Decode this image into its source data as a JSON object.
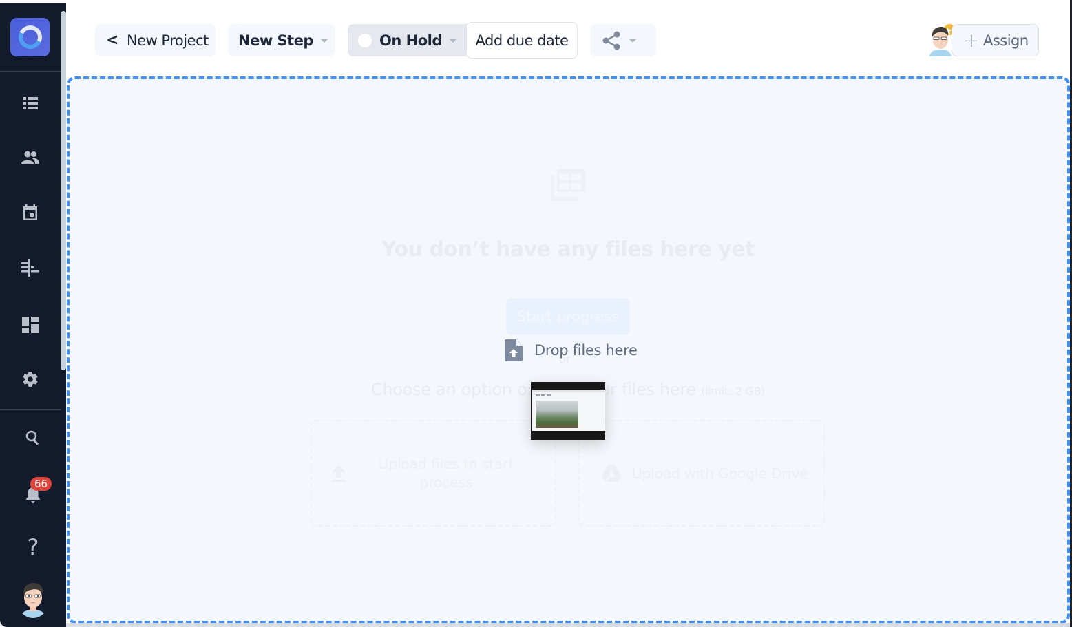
{
  "sidebar": {
    "logo": "app-logo",
    "nav_items": [
      {
        "name": "list-icon",
        "label": "Projects list"
      },
      {
        "name": "people-icon",
        "label": "Team"
      },
      {
        "name": "calendar-icon",
        "label": "Calendar"
      },
      {
        "name": "timeline-icon",
        "label": "Timeline"
      },
      {
        "name": "dashboard-icon",
        "label": "Dashboard"
      },
      {
        "name": "gear-icon",
        "label": "Settings"
      }
    ],
    "bottom_items": [
      {
        "name": "search-icon"
      },
      {
        "name": "bell-icon"
      },
      {
        "name": "help-icon"
      },
      {
        "name": "user-avatar"
      }
    ],
    "notification_count": "66",
    "help_glyph": "?"
  },
  "header": {
    "back_label": "New Project",
    "back_glyph": "<",
    "step_label": "New Step",
    "status_label": "On Hold",
    "due_date_label": "Add due date",
    "assign_label": "Assign",
    "assign_glyph": "+"
  },
  "dropzone": {
    "empty_title": "You don’t have any files here yet",
    "start_button": "Start progress",
    "drop_label": "Drop files here",
    "or_text": "or",
    "choose_text": "Choose an option or drop your files here",
    "limit_text": "(limit: 2 GB)",
    "upload_option": "Upload files to start process",
    "drive_option": "Upload with Google Drive"
  },
  "colors": {
    "sidebar_bg": "#131a2b",
    "accent_blue": "#3d8ff5",
    "badge_red": "#e0433a",
    "dropzone_bg": "#f4f7fb"
  }
}
